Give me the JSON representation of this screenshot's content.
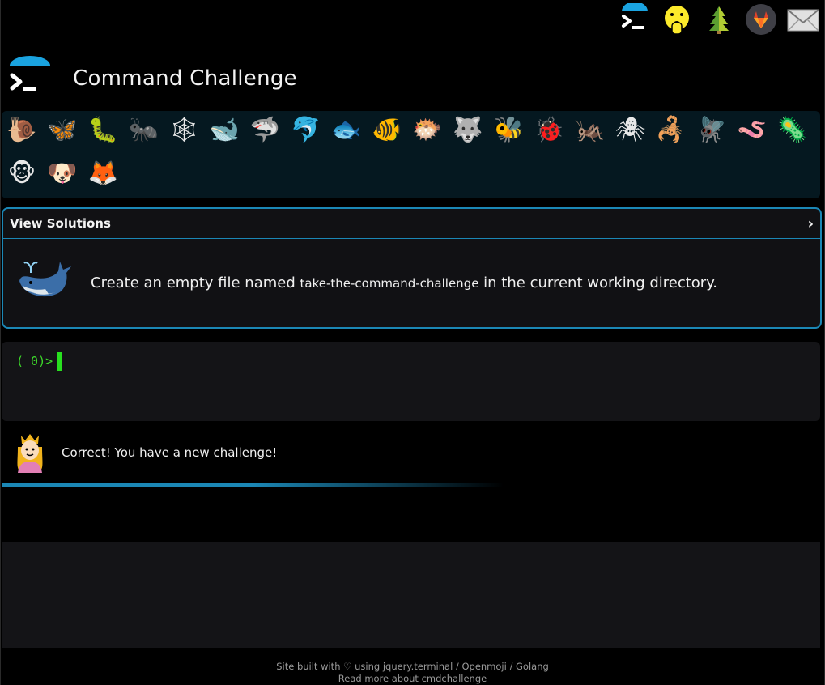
{
  "header": {
    "title": "Command Challenge",
    "logo_icon": "terminal-logo-icon"
  },
  "top_icons": [
    {
      "name": "terminal-icon"
    },
    {
      "name": "shushing-face-icon"
    },
    {
      "name": "tree-icon"
    },
    {
      "name": "gitlab-icon"
    },
    {
      "name": "mail-icon"
    }
  ],
  "animals": [
    {
      "name": "snail-icon",
      "glyph": "🐌"
    },
    {
      "name": "butterfly-icon",
      "glyph": "🦋"
    },
    {
      "name": "caterpillar-icon",
      "glyph": "🐛"
    },
    {
      "name": "ant-icon",
      "glyph": "🐜"
    },
    {
      "name": "spider-web-icon",
      "glyph": "🕸"
    },
    {
      "name": "whale-icon",
      "glyph": "🐋"
    },
    {
      "name": "shark-icon",
      "glyph": "🦈"
    },
    {
      "name": "dolphin-icon",
      "glyph": "🐬"
    },
    {
      "name": "fish-icon",
      "glyph": "🐟"
    },
    {
      "name": "tropical-fish-icon",
      "glyph": "🐠"
    },
    {
      "name": "blowfish-icon",
      "glyph": "🐡"
    },
    {
      "name": "wolf-icon",
      "glyph": "🐺"
    },
    {
      "name": "bee-icon",
      "glyph": "🐝"
    },
    {
      "name": "ladybug-icon",
      "glyph": "🐞"
    },
    {
      "name": "cricket-icon",
      "glyph": "🦗"
    },
    {
      "name": "spider-icon",
      "glyph": "🕷"
    },
    {
      "name": "scorpion-icon",
      "glyph": "🦂"
    },
    {
      "name": "fly-icon",
      "glyph": "🪰"
    },
    {
      "name": "worm-icon",
      "glyph": "🪱"
    },
    {
      "name": "microbe-icon",
      "glyph": "🦠"
    },
    {
      "name": "monkey-icon",
      "glyph": "🐵"
    },
    {
      "name": "dog-icon",
      "glyph": "🐶"
    },
    {
      "name": "fox-icon",
      "glyph": "🦊"
    }
  ],
  "solutions": {
    "title": "View Solutions",
    "chevron": "›",
    "challenge_prefix": "Create an empty file named ",
    "challenge_filename": "take-the-command-challenge",
    "challenge_suffix": " in the current working directory."
  },
  "terminal": {
    "prompt": "( 0)>"
  },
  "message": {
    "text": "Correct! You have a new challenge!"
  },
  "footer": {
    "line1_prefix": "Site built with ♡ using ",
    "jquery_link": "jquery.terminal",
    "sep1": " / ",
    "openmoji_link": "Openmoji",
    "sep2": " / ",
    "golang_link": "Golang",
    "line2_link": "Read more about cmdchallenge"
  },
  "colors": {
    "accent": "#1b87b5",
    "prompt_green": "#3ddb2a",
    "background": "#000000",
    "panel": "#141417",
    "animal_bar": "#051820"
  }
}
